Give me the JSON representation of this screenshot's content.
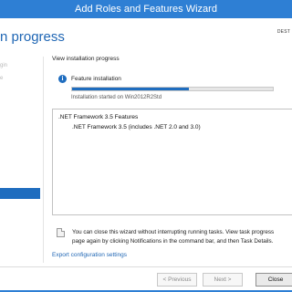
{
  "window": {
    "title": "Add Roles and Features Wizard"
  },
  "header": {
    "title": "n progress",
    "destination_label": "DEST"
  },
  "nav": {
    "items": [
      "gin",
      "e",
      ""
    ],
    "active_index": 3
  },
  "main": {
    "view_label": "View installation progress",
    "status": {
      "icon": "info-icon",
      "label": "Feature installation",
      "progress_fraction": 0.58,
      "started_text": "Installation started on Win2012R2Std"
    },
    "results": [
      ".NET Framework 3.5 Features",
      ".NET Framework 3.5 (includes .NET 2.0 and 3.0)"
    ],
    "note_lines": [
      "You can close this wizard without interrupting running tasks. View task progress",
      "page again by clicking Notifications in the command bar, and then Task Details."
    ],
    "export_link": "Export configuration settings"
  },
  "footer": {
    "previous_label": "< Previous",
    "next_label": "Next >",
    "close_label": "Close"
  },
  "colors": {
    "titlebar": "#2e7fd4",
    "accent": "#1f6dbf",
    "heading": "#1f66b4"
  }
}
